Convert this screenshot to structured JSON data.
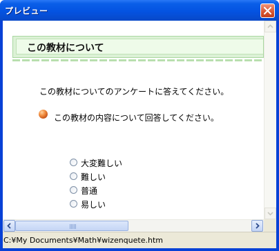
{
  "window": {
    "title": "プレビュー",
    "close_icon": "close-icon"
  },
  "content": {
    "heading": "この教材について",
    "intro": "この教材についてのアンケートに答えてください。",
    "question": "この教材の内容について回答してください。",
    "bullet_icon": "orange-ball-icon",
    "options": [
      "大変難しい",
      "難しい",
      "普通",
      "易しい"
    ]
  },
  "scrollbars": {
    "up_icon": "scroll-up-arrow-icon",
    "down_icon": "scroll-down-arrow-icon",
    "left_icon": "scroll-left-arrow-icon",
    "right_icon": "scroll-right-arrow-icon"
  },
  "status": {
    "path": "C:¥My Documents¥Math¥wizenquete.htm"
  },
  "colors": {
    "titlebar": "#0453e1",
    "heading_bg": "#eefbe9",
    "heading_border": "#a9d7a0",
    "close_button": "#d65430",
    "bullet": "#f08a3c"
  }
}
